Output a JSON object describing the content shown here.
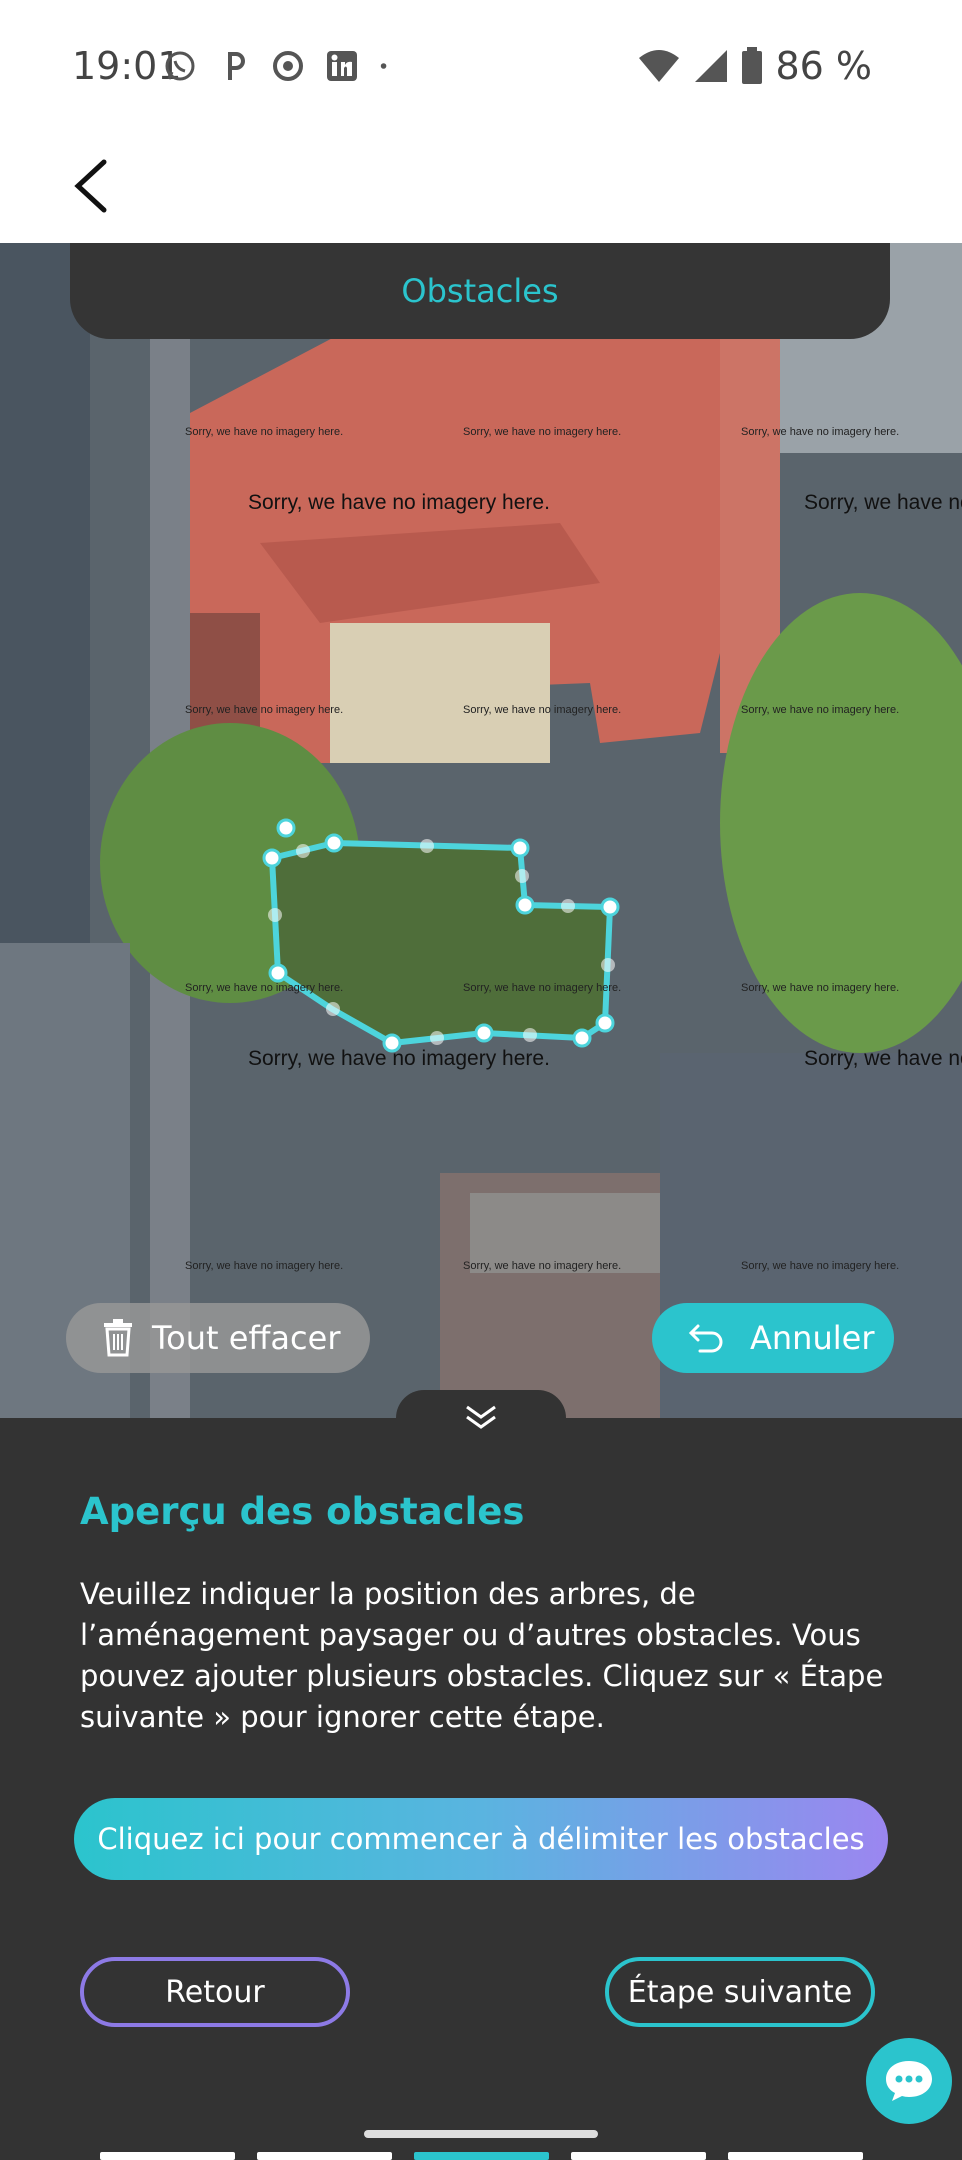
{
  "status_bar": {
    "time": "19:01",
    "battery": "86 %",
    "icons": [
      "whatsapp-icon",
      "p-icon",
      "chrome-icon",
      "linkedin-icon",
      "dot-icon"
    ],
    "right_icons": [
      "wifi-icon",
      "signal-icon",
      "battery-icon"
    ]
  },
  "header": {
    "back_icon": "chevron-left-icon"
  },
  "map": {
    "tab_label": "Obstacles",
    "no_imagery_text": "Sorry, we have no imagery here.",
    "no_imagery_text_cut": "Sorry, we have no",
    "clear_label": "Tout effacer",
    "clear_icon": "trash-icon",
    "undo_label": "Annuler",
    "undo_icon": "undo-icon",
    "polygon_color": "#4dd4dc"
  },
  "panel": {
    "title": "Aperçu des obstacles",
    "description": "Veuillez indiquer la position des arbres, de l’aménagement paysager ou d’autres obstacles. Vous pouvez ajouter plusieurs obstacles. Cliquez sur « Étape suivante » pour ignorer cette étape.",
    "start_label": "Cliquez ici pour commencer à délimiter les obstacles",
    "back_label": "Retour",
    "next_label": "Étape suivante",
    "collapse_icon": "double-chevron-down-icon",
    "chat_icon": "chat-bubble-icon"
  },
  "progress": {
    "steps": 5,
    "active_step": 3
  },
  "colors": {
    "accent": "#2bc4cd",
    "purple": "#8d7ae6",
    "panel_bg": "#333333"
  }
}
